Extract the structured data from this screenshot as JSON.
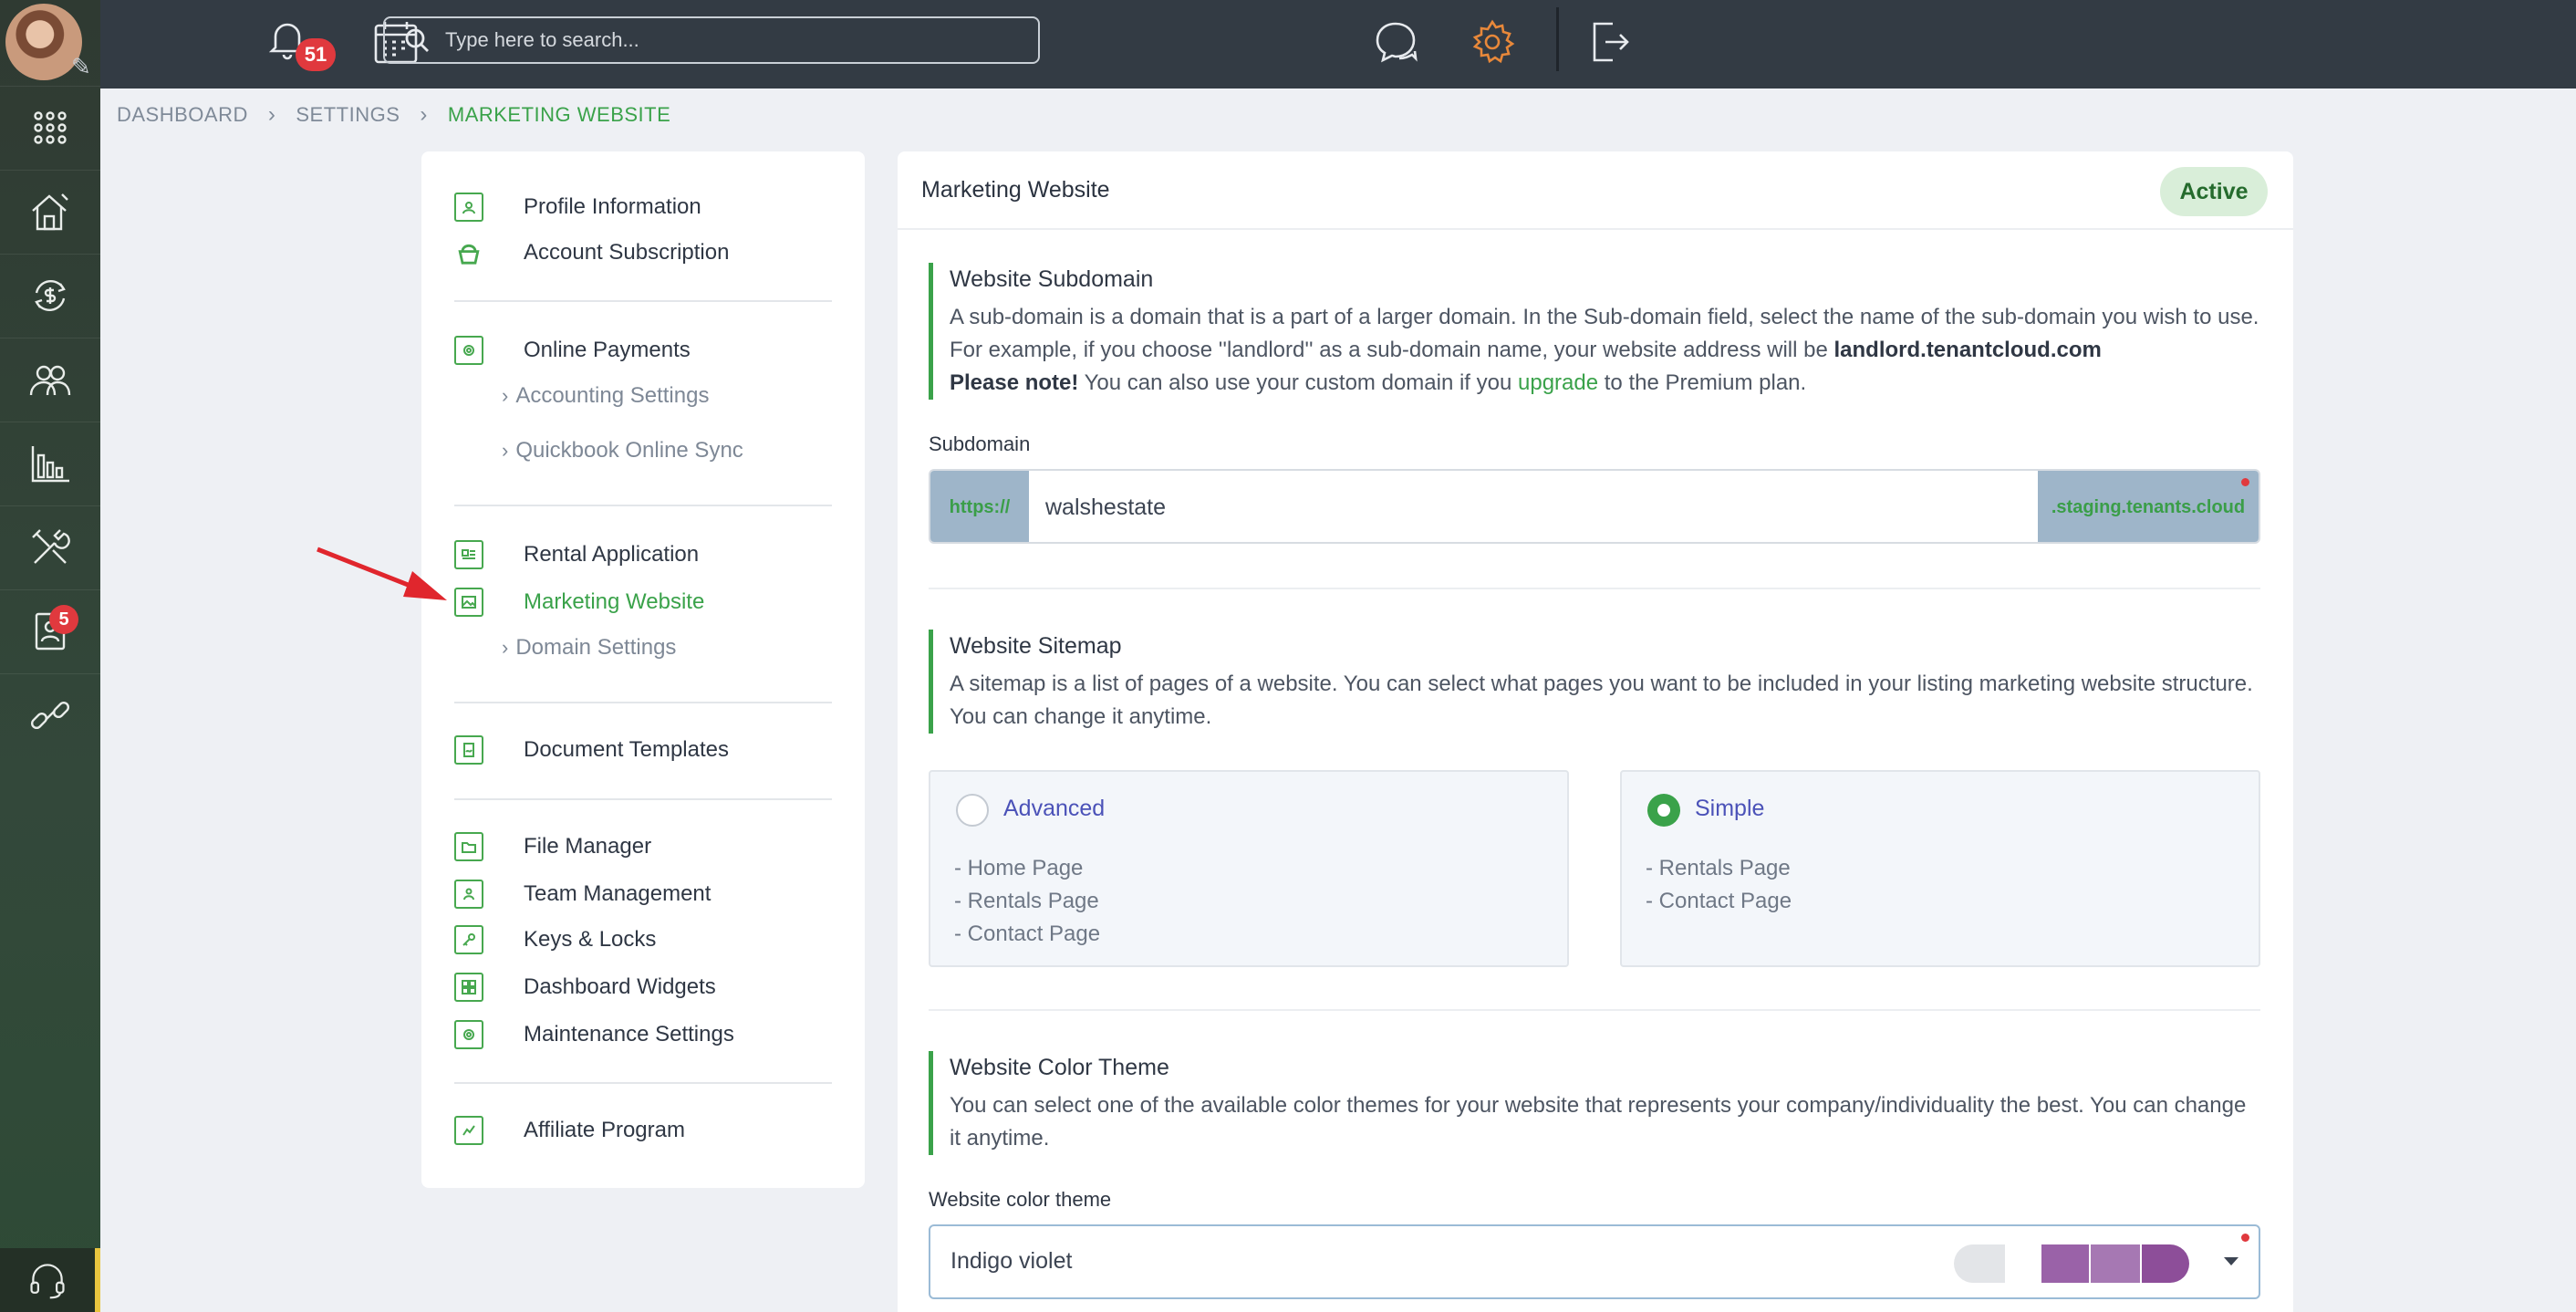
{
  "rail": {
    "items": [
      "apps-grid",
      "properties",
      "payments",
      "contacts",
      "reports",
      "maintenance",
      "applications",
      "integrations"
    ],
    "applications_badge": "5"
  },
  "topbar": {
    "notifications_count": "51",
    "search_placeholder": "Type here to search..."
  },
  "breadcrumb": {
    "items": [
      "DASHBOARD",
      "SETTINGS",
      "MARKETING WEBSITE"
    ]
  },
  "settings_nav": {
    "profile_information": "Profile Information",
    "account_subscription": "Account Subscription",
    "online_payments": "Online Payments",
    "accounting_settings": "Accounting Settings",
    "quickbook_online_sync": "Quickbook Online Sync",
    "rental_application": "Rental Application",
    "marketing_website": "Marketing Website",
    "domain_settings": "Domain Settings",
    "document_templates": "Document Templates",
    "file_manager": "File Manager",
    "team_management": "Team Management",
    "keys_locks": "Keys & Locks",
    "dashboard_widgets": "Dashboard Widgets",
    "maintenance_settings": "Maintenance Settings",
    "affiliate_program": "Affiliate Program"
  },
  "main": {
    "title": "Marketing Website",
    "status": "Active",
    "subdomain_section": {
      "title": "Website Subdomain",
      "text_1": "A sub-domain is a domain that is a part of a larger domain. In the Sub-domain field, select the name of the sub-domain you wish to use. For example, if you choose ''landlord'' as a sub-domain name, your website address will be ",
      "example_domain": "landlord.tenantcloud.com",
      "note_label": "Please note!",
      "note_text": " You can also use your custom domain if you ",
      "upgrade_link": "upgrade",
      "note_end": " to the Premium plan."
    },
    "subdomain_field": {
      "label": "Subdomain",
      "prefix": "https://",
      "value": "walshestate",
      "suffix": ".staging.tenants.cloud"
    },
    "sitemap_section": {
      "title": "Website Sitemap",
      "text": "A sitemap is a list of pages of a website. You can select what pages you want to be included in your listing marketing website structure. You can change it anytime."
    },
    "sitemap_options": {
      "advanced": {
        "label": "Advanced",
        "selected": false,
        "pages": [
          "- Home Page",
          "- Rentals Page",
          "- Contact Page"
        ]
      },
      "simple": {
        "label": "Simple",
        "selected": true,
        "pages": [
          "- Rentals Page",
          "- Contact Page"
        ]
      }
    },
    "color_theme_section": {
      "title": "Website Color Theme",
      "text": "You can select one of the available color themes for your website that represents your company/individuality the best. You can change it anytime."
    },
    "color_theme_field": {
      "label": "Website color theme",
      "value": "Indigo violet",
      "swatches": [
        "#e3e5e8",
        "#9a62a8",
        "#a678b3",
        "#8d4e99"
      ]
    }
  },
  "colors": {
    "accent_green": "#3aa24a",
    "topbar": "#333b44",
    "badge_red": "#e0393e",
    "option_title": "#4b52b8",
    "settings_gear": "#e8883a"
  }
}
